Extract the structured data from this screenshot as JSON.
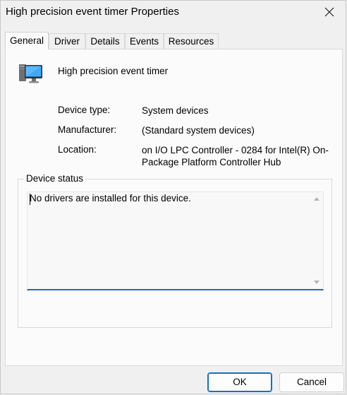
{
  "window": {
    "title": "High precision event timer Properties"
  },
  "tabs": [
    {
      "label": "General",
      "active": true
    },
    {
      "label": "Driver",
      "active": false
    },
    {
      "label": "Details",
      "active": false
    },
    {
      "label": "Events",
      "active": false
    },
    {
      "label": "Resources",
      "active": false
    }
  ],
  "general": {
    "device_name": "High precision event timer",
    "device_icon": "computer-monitor-icon",
    "properties": [
      {
        "label": "Device type:",
        "value": "System devices"
      },
      {
        "label": "Manufacturer:",
        "value": "(Standard system devices)"
      },
      {
        "label": "Location:",
        "value": "on I/O LPC Controller - 0284 for Intel(R) On-Package Platform Controller Hub"
      }
    ],
    "status_group_label": "Device status",
    "status_text": "No drivers are installed for this device."
  },
  "buttons": {
    "ok": "OK",
    "cancel": "Cancel"
  },
  "colors": {
    "accent": "#1a6fc4",
    "background": "#f0f0f0",
    "panel": "#fbfbfb"
  }
}
